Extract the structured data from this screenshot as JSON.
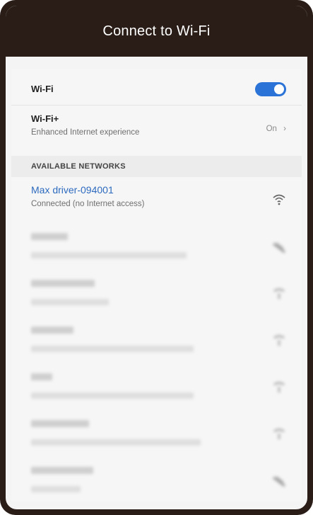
{
  "header": {
    "title": "Connect to Wi-Fi"
  },
  "wifi": {
    "label": "Wi-Fi",
    "enabled": true
  },
  "wifi_plus": {
    "label": "Wi-Fi+",
    "subtitle": "Enhanced Internet experience",
    "value": "On",
    "chevron": "›"
  },
  "section": {
    "label": "AVAILABLE NETWORKS"
  },
  "connected_network": {
    "name": "Max driver-094001",
    "status": "Connected (no Internet access)",
    "icon": "wifi-signal-icon"
  },
  "blurred_networks": [
    {
      "icon": "wifi-signal-lock-icon"
    },
    {
      "icon": "wifi-signal-icon"
    },
    {
      "icon": "wifi-signal-icon"
    },
    {
      "icon": "wifi-signal-icon"
    },
    {
      "icon": "wifi-signal-icon"
    },
    {
      "icon": "wifi-signal-lock-icon"
    }
  ],
  "colors": {
    "frame": "#2a1d17",
    "accent": "#2b73d6",
    "link": "#2e6bbf"
  }
}
